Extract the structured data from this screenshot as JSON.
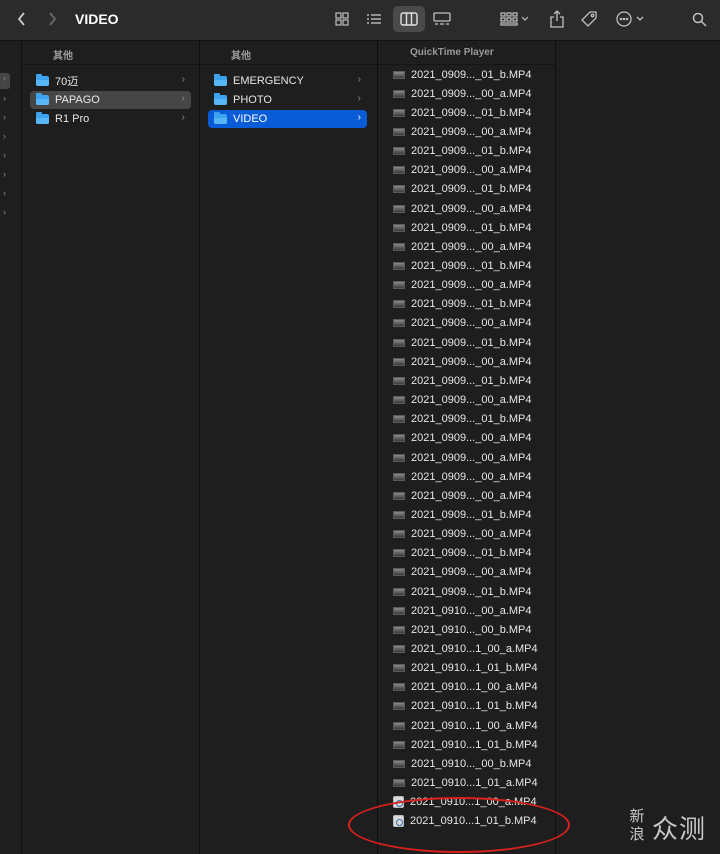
{
  "toolbar": {
    "title": "VIDEO",
    "back_icon": "chevron-left-icon",
    "forward_icon": "chevron-right-icon",
    "icons": [
      "grid-view-icon",
      "list-view-icon",
      "column-view-icon",
      "gallery-view-icon",
      "group-icon",
      "share-icon",
      "tag-icon",
      "more-icon",
      "search-icon"
    ]
  },
  "col1": {
    "header": "其他",
    "items": [
      {
        "label": "70迈"
      },
      {
        "label": "PAPAGO"
      },
      {
        "label": "R1 Pro"
      }
    ]
  },
  "col2": {
    "header": "其他",
    "items": [
      {
        "label": "EMERGENCY"
      },
      {
        "label": "PHOTO"
      },
      {
        "label": "VIDEO"
      }
    ]
  },
  "col3": {
    "header": "QuickTime Player",
    "files": [
      "2021_0909..._01_b.MP4",
      "2021_0909..._00_a.MP4",
      "2021_0909..._01_b.MP4",
      "2021_0909..._00_a.MP4",
      "2021_0909..._01_b.MP4",
      "2021_0909..._00_a.MP4",
      "2021_0909..._01_b.MP4",
      "2021_0909..._00_a.MP4",
      "2021_0909..._01_b.MP4",
      "2021_0909..._00_a.MP4",
      "2021_0909..._01_b.MP4",
      "2021_0909..._00_a.MP4",
      "2021_0909..._01_b.MP4",
      "2021_0909..._00_a.MP4",
      "2021_0909..._01_b.MP4",
      "2021_0909..._00_a.MP4",
      "2021_0909..._01_b.MP4",
      "2021_0909..._00_a.MP4",
      "2021_0909..._01_b.MP4",
      "2021_0909..._00_a.MP4",
      "2021_0909..._00_a.MP4",
      "2021_0909..._00_a.MP4",
      "2021_0909..._00_a.MP4",
      "2021_0909..._01_b.MP4",
      "2021_0909..._00_a.MP4",
      "2021_0909..._01_b.MP4",
      "2021_0909..._00_a.MP4",
      "2021_0909..._01_b.MP4",
      "2021_0910..._00_a.MP4",
      "2021_0910..._00_b.MP4",
      "2021_0910...1_00_a.MP4",
      "2021_0910...1_01_b.MP4",
      "2021_0910...1_00_a.MP4",
      "2021_0910...1_01_b.MP4",
      "2021_0910...1_00_a.MP4",
      "2021_0910...1_01_b.MP4",
      "2021_0910..._00_b.MP4",
      "2021_0910...1_01_a.MP4",
      "2021_0910...1_00_a.MP4",
      "2021_0910...1_01_b.MP4"
    ]
  },
  "watermark": {
    "left": "新浪",
    "right": "众测"
  },
  "colors": {
    "selection_blue": "#0a5bd6",
    "folder_blue": "#3ba3f0",
    "annotation_red": "#d8211d"
  }
}
